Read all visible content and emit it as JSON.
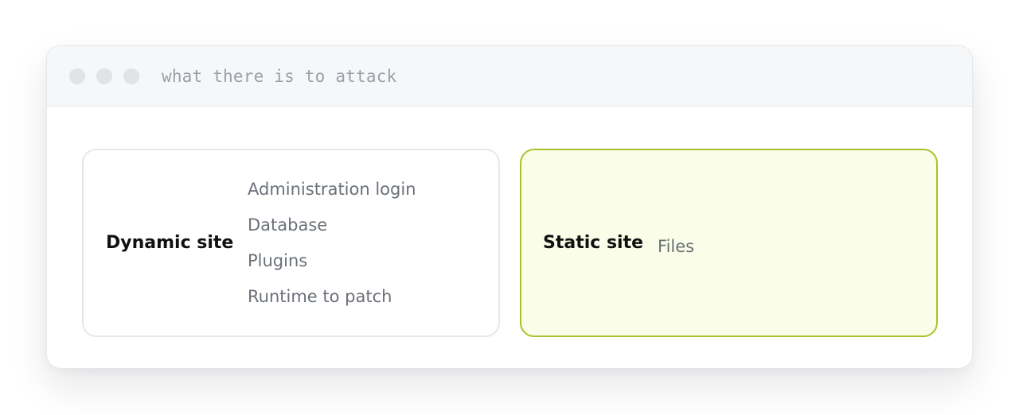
{
  "window": {
    "title": "what there is to attack"
  },
  "panels": {
    "dynamic": {
      "title": "Dynamic site",
      "items": [
        "Administration login",
        "Database",
        "Plugins",
        "Runtime to patch"
      ]
    },
    "static": {
      "title": "Static site",
      "items": [
        "Files"
      ]
    }
  },
  "colors": {
    "static_border": "#a8c22c",
    "static_fill": "#fafee8",
    "dynamic_border": "#e6e7ea"
  }
}
